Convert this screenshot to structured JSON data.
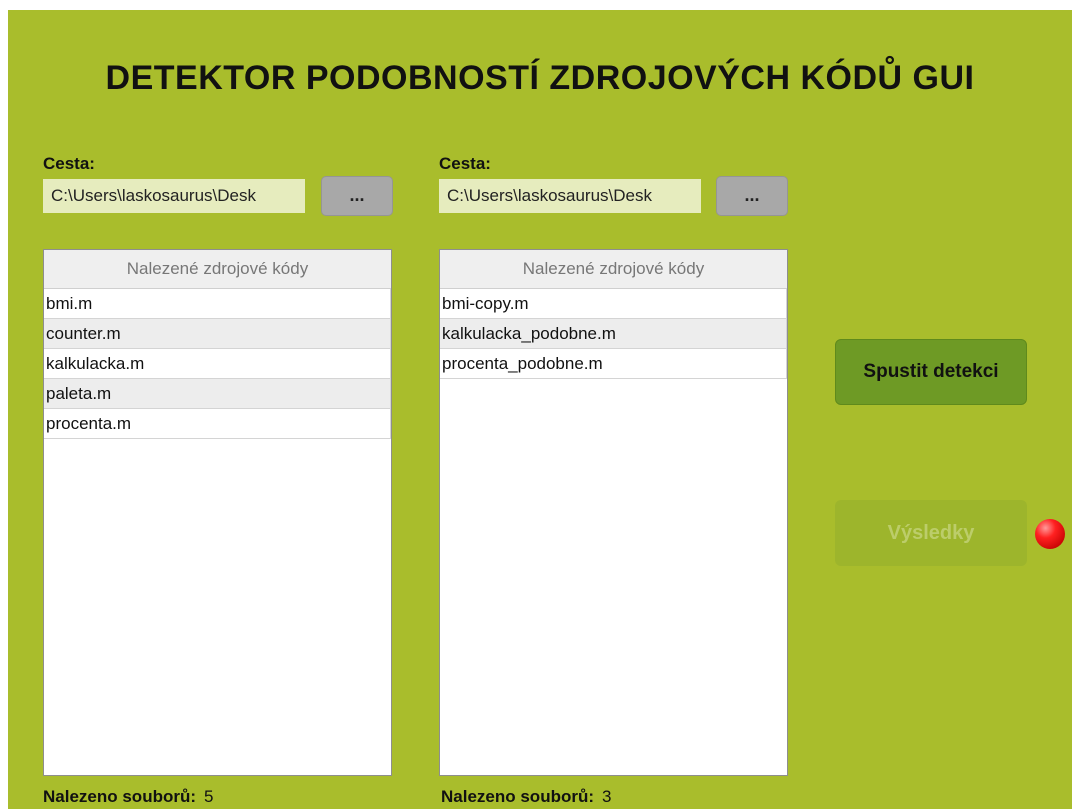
{
  "app": {
    "title": "DETEKTOR PODOBNOSTÍ ZDROJOVÝCH KÓDŮ GUI"
  },
  "left_panel": {
    "path_label": "Cesta:",
    "path_value": "C:\\Users\\laskosaurus\\Desk",
    "browse_label": "...",
    "list_header": "Nalezené zdrojové kódy",
    "files": [
      "bmi.m",
      "counter.m",
      "kalkulacka.m",
      "paleta.m",
      "procenta.m"
    ],
    "count_label": "Nalezeno souborů:",
    "count_value": "5"
  },
  "right_panel": {
    "path_label": "Cesta:",
    "path_value": "C:\\Users\\laskosaurus\\Desk",
    "browse_label": "...",
    "list_header": "Nalezené zdrojové kódy",
    "files": [
      "bmi-copy.m",
      "kalkulacka_podobne.m",
      "procenta_podobne.m"
    ],
    "count_label": "Nalezeno souborů:",
    "count_value": "3"
  },
  "actions": {
    "run_label": "Spustit detekci",
    "results_label": "Výsledky",
    "status_color": "#ff2020"
  }
}
